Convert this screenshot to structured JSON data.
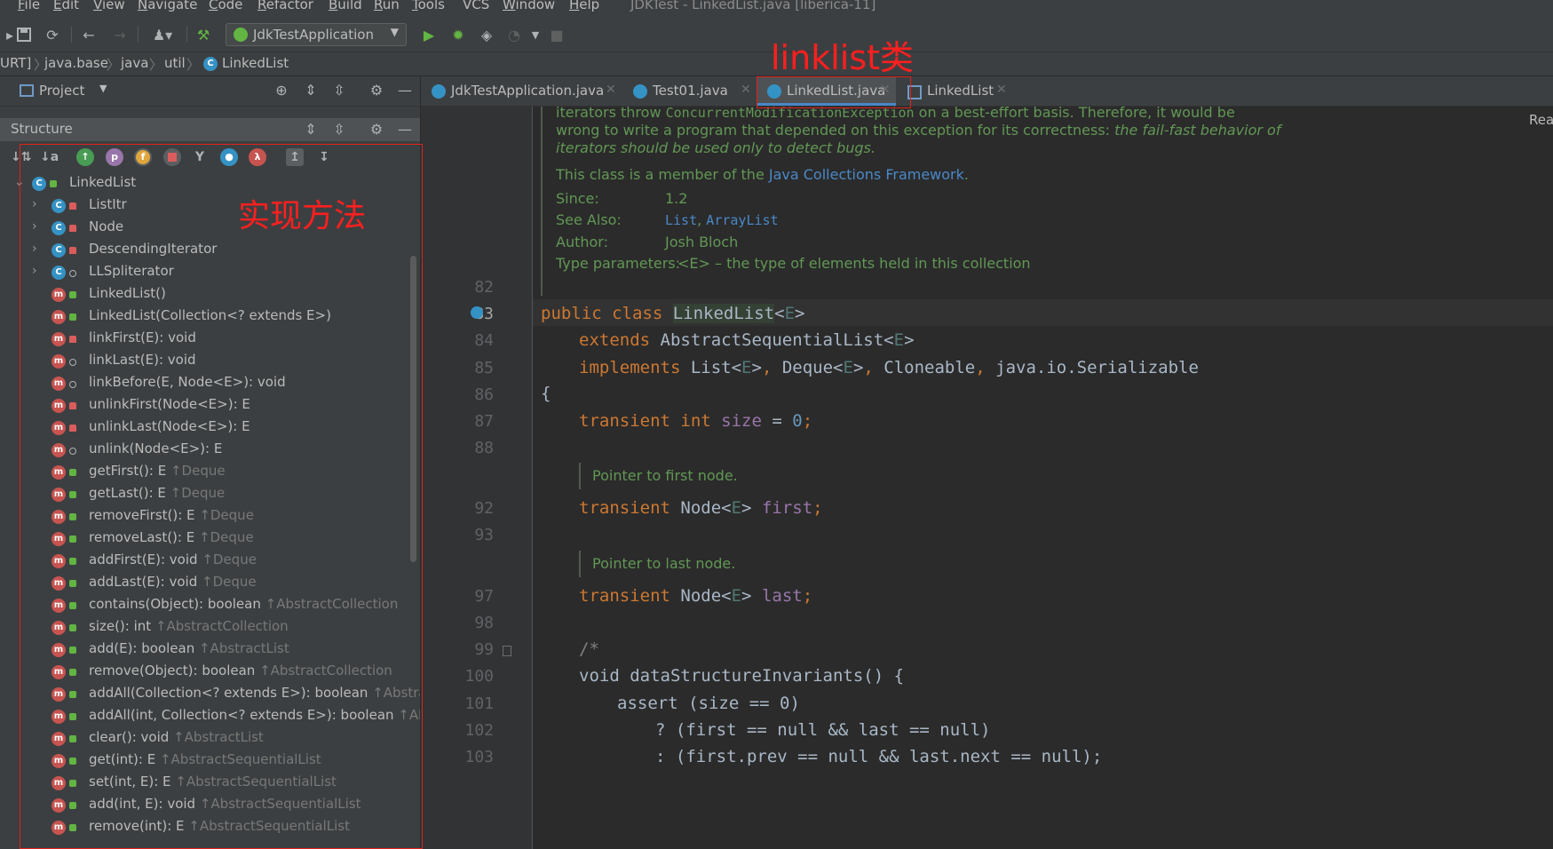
{
  "menu": {
    "items": [
      {
        "underline": "F",
        "rest": "ile"
      },
      {
        "underline": "E",
        "rest": "dit"
      },
      {
        "underline": "V",
        "rest": "iew"
      },
      {
        "underline": "N",
        "rest": "avigate"
      },
      {
        "underline": "C",
        "rest": "ode"
      },
      {
        "underline": "R",
        "rest": "efactor"
      },
      {
        "underline": "B",
        "rest": "uild"
      },
      {
        "underline": "R",
        "rest": "un"
      },
      {
        "underline": "T",
        "rest": "ools"
      },
      {
        "underline": "",
        "rest": "VCS"
      },
      {
        "underline": "W",
        "rest": "indow"
      },
      {
        "underline": "H",
        "rest": "elp"
      }
    ],
    "window_title": "JDKTest - LinkedList.java [liberica-11]"
  },
  "toolbar": {
    "run_config": "JdkTestApplication"
  },
  "breadcrumb": [
    "URT]",
    "java.base",
    "java",
    "util",
    "LinkedList"
  ],
  "project_panel": {
    "label": "Project"
  },
  "structure_panel": {
    "title": "Structure",
    "tree": [
      {
        "kind": "class",
        "vis": "public",
        "label": "LinkedList",
        "inherit": "",
        "arrow": "open",
        "depth": 0
      },
      {
        "kind": "class",
        "vis": "private",
        "label": "ListItr",
        "inherit": "",
        "arrow": "closed",
        "depth": 1
      },
      {
        "kind": "class",
        "vis": "private",
        "label": "Node",
        "inherit": "",
        "arrow": "closed",
        "depth": 1
      },
      {
        "kind": "class",
        "vis": "private",
        "label": "DescendingIterator",
        "inherit": "",
        "arrow": "closed",
        "depth": 1
      },
      {
        "kind": "class",
        "vis": "package",
        "label": "LLSpliterator",
        "inherit": "",
        "arrow": "closed",
        "depth": 1
      },
      {
        "kind": "method",
        "vis": "public",
        "label": "LinkedList()",
        "inherit": "",
        "arrow": "",
        "depth": 1
      },
      {
        "kind": "method",
        "vis": "public",
        "label": "LinkedList(Collection<? extends E>)",
        "inherit": "",
        "arrow": "",
        "depth": 1
      },
      {
        "kind": "method",
        "vis": "private",
        "label": "linkFirst(E): void",
        "inherit": "",
        "arrow": "",
        "depth": 1
      },
      {
        "kind": "method",
        "vis": "package",
        "label": "linkLast(E): void",
        "inherit": "",
        "arrow": "",
        "depth": 1
      },
      {
        "kind": "method",
        "vis": "package",
        "label": "linkBefore(E, Node<E>): void",
        "inherit": "",
        "arrow": "",
        "depth": 1
      },
      {
        "kind": "method",
        "vis": "private",
        "label": "unlinkFirst(Node<E>): E",
        "inherit": "",
        "arrow": "",
        "depth": 1
      },
      {
        "kind": "method",
        "vis": "private",
        "label": "unlinkLast(Node<E>): E",
        "inherit": "",
        "arrow": "",
        "depth": 1
      },
      {
        "kind": "method",
        "vis": "package",
        "label": "unlink(Node<E>): E",
        "inherit": "",
        "arrow": "",
        "depth": 1
      },
      {
        "kind": "method",
        "vis": "public",
        "label": "getFirst(): E ",
        "inherit": "↑Deque",
        "arrow": "",
        "depth": 1
      },
      {
        "kind": "method",
        "vis": "public",
        "label": "getLast(): E ",
        "inherit": "↑Deque",
        "arrow": "",
        "depth": 1
      },
      {
        "kind": "method",
        "vis": "public",
        "label": "removeFirst(): E ",
        "inherit": "↑Deque",
        "arrow": "",
        "depth": 1
      },
      {
        "kind": "method",
        "vis": "public",
        "label": "removeLast(): E ",
        "inherit": "↑Deque",
        "arrow": "",
        "depth": 1
      },
      {
        "kind": "method",
        "vis": "public",
        "label": "addFirst(E): void ",
        "inherit": "↑Deque",
        "arrow": "",
        "depth": 1
      },
      {
        "kind": "method",
        "vis": "public",
        "label": "addLast(E): void ",
        "inherit": "↑Deque",
        "arrow": "",
        "depth": 1
      },
      {
        "kind": "method",
        "vis": "public",
        "label": "contains(Object): boolean ",
        "inherit": "↑AbstractCollection",
        "arrow": "",
        "depth": 1
      },
      {
        "kind": "method",
        "vis": "public",
        "label": "size(): int ",
        "inherit": "↑AbstractCollection",
        "arrow": "",
        "depth": 1
      },
      {
        "kind": "method",
        "vis": "public",
        "label": "add(E): boolean ",
        "inherit": "↑AbstractList",
        "arrow": "",
        "depth": 1
      },
      {
        "kind": "method",
        "vis": "public",
        "label": "remove(Object): boolean ",
        "inherit": "↑AbstractCollection",
        "arrow": "",
        "depth": 1
      },
      {
        "kind": "method",
        "vis": "public",
        "label": "addAll(Collection<? extends E>): boolean ",
        "inherit": "↑Abstrac",
        "arrow": "",
        "depth": 1
      },
      {
        "kind": "method",
        "vis": "public",
        "label": "addAll(int, Collection<? extends E>): boolean ",
        "inherit": "↑Abs",
        "arrow": "",
        "depth": 1
      },
      {
        "kind": "method",
        "vis": "public",
        "label": "clear(): void ",
        "inherit": "↑AbstractList",
        "arrow": "",
        "depth": 1
      },
      {
        "kind": "method",
        "vis": "public",
        "label": "get(int): E ",
        "inherit": "↑AbstractSequentialList",
        "arrow": "",
        "depth": 1
      },
      {
        "kind": "method",
        "vis": "public",
        "label": "set(int, E): E ",
        "inherit": "↑AbstractSequentialList",
        "arrow": "",
        "depth": 1
      },
      {
        "kind": "method",
        "vis": "public",
        "label": "add(int, E): void ",
        "inherit": "↑AbstractSequentialList",
        "arrow": "",
        "depth": 1
      },
      {
        "kind": "method",
        "vis": "public",
        "label": "remove(int): E ",
        "inherit": "↑AbstractSequentialList",
        "arrow": "",
        "depth": 1
      }
    ]
  },
  "annotations": {
    "methods_note": "实现方法",
    "class_note": "linklist类"
  },
  "tabs": [
    {
      "label": "JdkTestApplication.java",
      "active": false,
      "icon": "class"
    },
    {
      "label": "Test01.java",
      "active": false,
      "icon": "class"
    },
    {
      "label": "LinkedList.java",
      "active": true,
      "icon": "class"
    },
    {
      "label": "LinkedList",
      "active": false,
      "icon": "struct"
    }
  ],
  "editor": {
    "right_edge_text": "Rea",
    "doc": {
      "line1_a": "iterators throw ",
      "line1_code": "ConcurrentModificationException",
      "line1_b": " on a best-effort basis. Therefore, it would be",
      "line2_a": "wrong to write a program that depended on this exception for its correctness: ",
      "line2_i": "the fail-fast behavior of",
      "line3_i": "iterators should be used only to detect bugs.",
      "member_a": "This class is a member of the ",
      "member_link": "Java Collections Framework",
      "member_b": ".",
      "since_label": "Since:",
      "since_val": "1.2",
      "see_label": "See Also:",
      "see_link1": "List",
      "see_comma": ", ",
      "see_link2": "ArrayList",
      "author_label": "Author:",
      "author_val": "Josh Bloch",
      "type_label": "Type parameters:",
      "type_val": "<E> – the type of elements held in this collection"
    },
    "line_numbers": [
      "82",
      "83",
      "84",
      "85",
      "86",
      "87",
      "88",
      "92",
      "93",
      "97",
      "98",
      "99",
      "100",
      "101",
      "102",
      "103"
    ],
    "inline_docs": [
      "Pointer to first node.",
      "Pointer to last node."
    ],
    "code": {
      "l83_kw1": "public class ",
      "l83_name": "LinkedList",
      "l83_lt": "<",
      "l83_tp": "E",
      "l83_gt": ">",
      "l84_kw": "extends ",
      "l84_name": "AbstractSequentialList<",
      "l84_tp": "E",
      "l84_gt": ">",
      "l85_kw": "implements ",
      "l85_a": "List<",
      "l85_tp1": "E",
      "l85_b": ">",
      "l85_c1": ", ",
      "l85_c": "Deque<",
      "l85_tp2": "E",
      "l85_d": ">",
      "l85_c2": ", ",
      "l85_e": "Cloneable",
      "l85_c3": ", ",
      "l85_f": "java.io.Serializable",
      "l86": "{",
      "l87_kw": "transient int ",
      "l87_fld": "size",
      "l87_eq": " = ",
      "l87_num": "0",
      "l87_semi": ";",
      "l92_kw": "transient ",
      "l92_type": "Node<",
      "l92_tp": "E",
      "l92_gt": "> ",
      "l92_fld": "first",
      "l92_semi": ";",
      "l97_kw": "transient ",
      "l97_type": "Node<",
      "l97_tp": "E",
      "l97_gt": "> ",
      "l97_fld": "last",
      "l97_semi": ";",
      "l99": "/*",
      "l100": "void dataStructureInvariants() {",
      "l101": "assert (size == 0)",
      "l102": "? (first == null && last == null)",
      "l103": ": (first.prev == null && last.next == null);"
    }
  }
}
